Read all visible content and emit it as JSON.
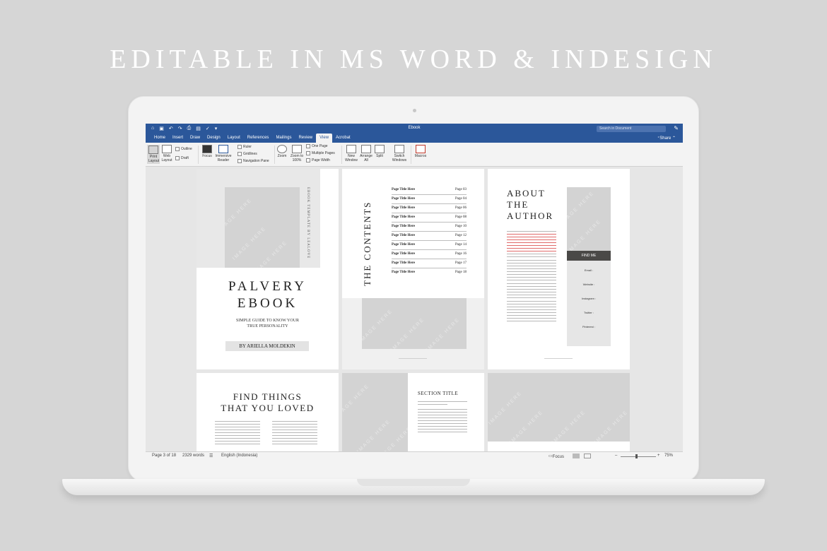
{
  "headline": "EDITABLE IN MS WORD & INDESIGN",
  "window": {
    "title": "Ebook",
    "search_placeholder": "Search in Document",
    "share_label": "Share"
  },
  "tabs": [
    "Home",
    "Insert",
    "Draw",
    "Design",
    "Layout",
    "References",
    "Mailings",
    "Review",
    "View",
    "Acrobat"
  ],
  "active_tab": "View",
  "ribbon": {
    "print_layout": "Print Layout",
    "web_layout": "Web Layout",
    "outline": "Outline",
    "draft": "Draft",
    "focus": "Focus",
    "immersive_reader": "Immersive Reader",
    "ruler": "Ruler",
    "gridlines": "Gridlines",
    "navigation_pane": "Navigation Pane",
    "zoom": "Zoom",
    "zoom_100": "Zoom to 100%",
    "one_page": "One Page",
    "multiple_pages": "Multiple Pages",
    "page_width": "Page Width",
    "new_window": "New Window",
    "arrange_all": "Arrange All",
    "split": "Split",
    "switch_windows": "Switch Windows",
    "macros": "Macros"
  },
  "pages": {
    "cover": {
      "vertical": "EBOOK TEMPLATE BY LEALOVE",
      "title1": "PALVERY",
      "title2": "EBOOK",
      "subtitle1": "SIMPLE GUIDE TO KNOW YOUR",
      "subtitle2": "TRUE PERSONALITY",
      "author": "BY ARIELLA MOLDEKIN"
    },
    "contents": {
      "heading": "THE CONTENTS",
      "rows": [
        {
          "title": "Page Title Here",
          "page": "Page 03"
        },
        {
          "title": "Page Title Here",
          "page": "Page 04"
        },
        {
          "title": "Page Title Here",
          "page": "Page 06"
        },
        {
          "title": "Page Title Here",
          "page": "Page 08"
        },
        {
          "title": "Page Title Here",
          "page": "Page 10"
        },
        {
          "title": "Page Title Here",
          "page": "Page 12"
        },
        {
          "title": "Page Title Here",
          "page": "Page 14"
        },
        {
          "title": "Page Title Here",
          "page": "Page 16"
        },
        {
          "title": "Page Title Here",
          "page": "Page 17"
        },
        {
          "title": "Page Title Here",
          "page": "Page 18"
        }
      ]
    },
    "about": {
      "line1": "ABOUT",
      "line2": "THE",
      "line3": "AUTHOR",
      "find_me": "FIND ME",
      "contacts": [
        "Email :",
        "Website :",
        "Instagram :",
        "Twitter :",
        "Pinterest :"
      ]
    },
    "find_things": {
      "line1": "FIND THINGS",
      "line2": "THAT YOU LOVED"
    },
    "section": {
      "title": "SECTION TITLE"
    },
    "image_watermark": "IMAGE HERE"
  },
  "status": {
    "page": "Page 3 of 18",
    "words": "2329 words",
    "language": "English (Indonesia)",
    "focus": "Focus",
    "zoom": "75%"
  },
  "colors": {
    "word_blue": "#2b579a",
    "placeholder_gray": "#d3d3d3",
    "find_me_bar": "#4a4947"
  }
}
